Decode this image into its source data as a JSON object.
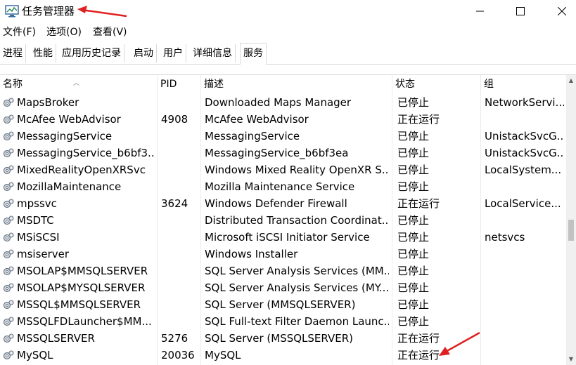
{
  "window": {
    "title": "任务管理器"
  },
  "menu": [
    "文件(F)",
    "选项(O)",
    "查看(V)"
  ],
  "tabs": [
    "进程",
    "性能",
    "应用历史记录",
    "启动",
    "用户",
    "详细信息",
    "服务"
  ],
  "active_tab": "服务",
  "columns": {
    "name": "名称",
    "pid": "PID",
    "desc": "描述",
    "status": "状态",
    "group": "组"
  },
  "rows": [
    {
      "name": "MapsBroker",
      "pid": "",
      "desc": "Downloaded Maps Manager",
      "status": "已停止",
      "group": "NetworkServi..."
    },
    {
      "name": "McAfee WebAdvisor",
      "pid": "4908",
      "desc": "McAfee WebAdvisor",
      "status": "正在运行",
      "group": ""
    },
    {
      "name": "MessagingService",
      "pid": "",
      "desc": "MessagingService",
      "status": "已停止",
      "group": "UnistackSvcG..."
    },
    {
      "name": "MessagingService_b6bf3...",
      "pid": "",
      "desc": "MessagingService_b6bf3ea",
      "status": "已停止",
      "group": "UnistackSvcG..."
    },
    {
      "name": "MixedRealityOpenXRSvc",
      "pid": "",
      "desc": "Windows Mixed Reality OpenXR S...",
      "status": "已停止",
      "group": "LocalSystem..."
    },
    {
      "name": "MozillaMaintenance",
      "pid": "",
      "desc": "Mozilla Maintenance Service",
      "status": "已停止",
      "group": ""
    },
    {
      "name": "mpssvc",
      "pid": "3624",
      "desc": "Windows Defender Firewall",
      "status": "正在运行",
      "group": "LocalService..."
    },
    {
      "name": "MSDTC",
      "pid": "",
      "desc": "Distributed Transaction Coordinat...",
      "status": "已停止",
      "group": ""
    },
    {
      "name": "MSiSCSI",
      "pid": "",
      "desc": "Microsoft iSCSI Initiator Service",
      "status": "已停止",
      "group": "netsvcs"
    },
    {
      "name": "msiserver",
      "pid": "",
      "desc": "Windows Installer",
      "status": "已停止",
      "group": ""
    },
    {
      "name": "MSOLAP$MMSQLSERVER",
      "pid": "",
      "desc": "SQL Server Analysis Services (MM...",
      "status": "已停止",
      "group": ""
    },
    {
      "name": "MSOLAP$MYSQLSERVER",
      "pid": "",
      "desc": "SQL Server Analysis Services (MY...",
      "status": "已停止",
      "group": ""
    },
    {
      "name": "MSSQL$MMSQLSERVER",
      "pid": "",
      "desc": "SQL Server (MMSQLSERVER)",
      "status": "已停止",
      "group": ""
    },
    {
      "name": "MSSQLFDLauncher$MM...",
      "pid": "",
      "desc": "SQL Full-text Filter Daemon Launc...",
      "status": "已停止",
      "group": ""
    },
    {
      "name": "MSSQLSERVER",
      "pid": "5276",
      "desc": "SQL Server (MSSQLSERVER)",
      "status": "正在运行",
      "group": ""
    },
    {
      "name": "MySQL",
      "pid": "20036",
      "desc": "MySQL",
      "status": "正在运行",
      "group": ""
    }
  ],
  "colors": {
    "annotation_arrow": "#e02020",
    "tab_border": "#d9d9d9",
    "scroll_thumb": "#c2c2c2"
  },
  "icons": [
    "task-manager-icon",
    "minimize-icon",
    "maximize-icon",
    "close-icon",
    "service-gear-icon",
    "sort-ascending-icon",
    "scroll-up-icon",
    "scroll-down-icon"
  ]
}
